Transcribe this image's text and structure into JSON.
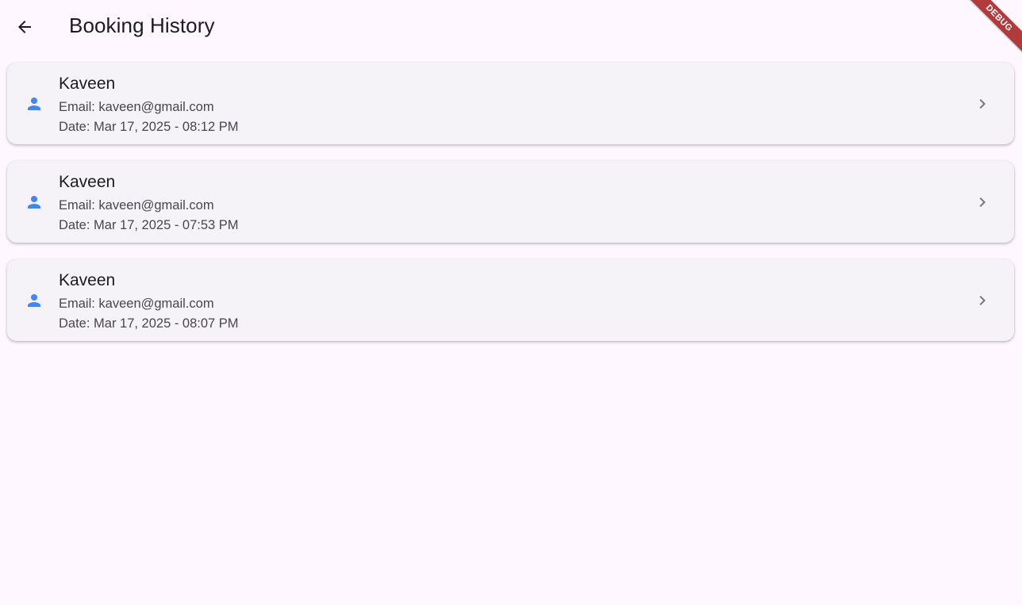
{
  "appbar": {
    "title": "Booking History",
    "back_icon": "arrow-back-icon"
  },
  "debug_banner": {
    "label": "DEBUG",
    "color": "#b13b3b"
  },
  "theme": {
    "background": "#fef7ff",
    "card_background": "#f5f2f8",
    "accent": "#4285f4",
    "chevron": "#79747e"
  },
  "bookings": [
    {
      "name": "Kaveen",
      "email": "Email: kaveen@gmail.com",
      "date": "Date: Mar 17, 2025 - 08:12 PM",
      "icon": "person-icon",
      "trailing_icon": "chevron-right-icon"
    },
    {
      "name": "Kaveen",
      "email": "Email: kaveen@gmail.com",
      "date": "Date: Mar 17, 2025 - 07:53 PM",
      "icon": "person-icon",
      "trailing_icon": "chevron-right-icon"
    },
    {
      "name": "Kaveen",
      "email": "Email: kaveen@gmail.com",
      "date": "Date: Mar 17, 2025 - 08:07 PM",
      "icon": "person-icon",
      "trailing_icon": "chevron-right-icon"
    }
  ]
}
